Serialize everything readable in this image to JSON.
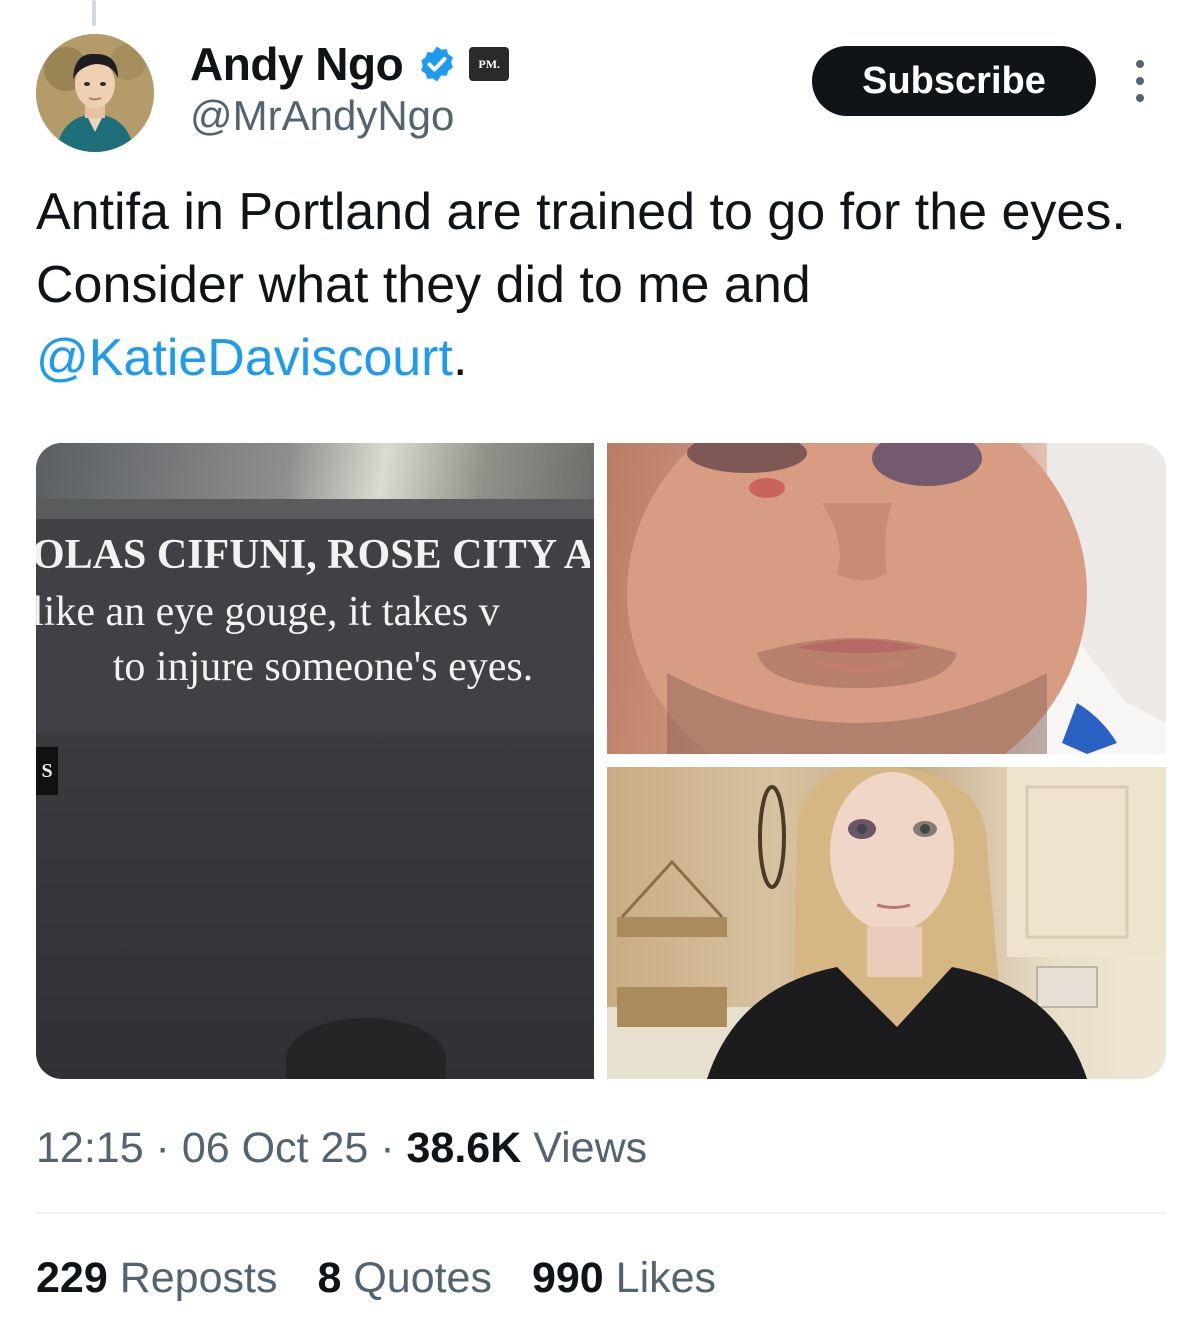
{
  "author": {
    "display_name": "Andy Ngo",
    "handle": "@MrAndyNgo",
    "verified_icon": "verified-badge-icon",
    "affiliation_badge": "PM."
  },
  "header": {
    "subscribe_label": "Subscribe",
    "more_icon": "more-vertical-icon"
  },
  "tweet": {
    "text_part1": "Antifa in Portland are trained to go for the eyes. Consider what they did to me and ",
    "mention": "@KatieDaviscourt",
    "text_part2": "."
  },
  "media": {
    "left_caption_line1": "OLAS CIFUNI, ROSE CITY A",
    "left_caption_line2": "like an eye gouge, it takes v",
    "left_caption_line3": "to injure someone's eyes.",
    "left_tag": "S"
  },
  "meta": {
    "time": "12:15",
    "date": "06 Oct 25",
    "views_count": "38.6K",
    "views_label": "Views"
  },
  "stats": {
    "reposts_count": "229",
    "reposts_label": "Reposts",
    "quotes_count": "8",
    "quotes_label": "Quotes",
    "likes_count": "990",
    "likes_label": "Likes"
  },
  "colors": {
    "link": "#1d9bf0",
    "text": "#0f1419",
    "secondary": "#536471",
    "button_bg": "#0f1419"
  }
}
